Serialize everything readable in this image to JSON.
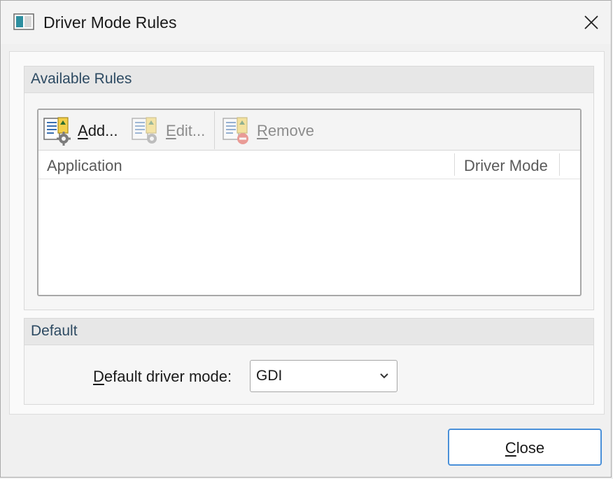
{
  "window": {
    "title": "Driver Mode Rules",
    "icon": "app-window-icon",
    "close_icon": "close-icon"
  },
  "available_rules": {
    "title": "Available Rules",
    "toolbar": {
      "add_label": "Add...",
      "edit_label": "Edit...",
      "remove_label": "Remove"
    },
    "columns": [
      "Application",
      "Driver Mode"
    ],
    "rows": []
  },
  "default_group": {
    "title": "Default",
    "label": "Default driver mode:",
    "selected": "GDI"
  },
  "footer": {
    "close_label": "Close"
  },
  "colors": {
    "accent": "#4a90d9",
    "group_title": "#2d4a62",
    "disabled_text": "#8c8c8c"
  }
}
